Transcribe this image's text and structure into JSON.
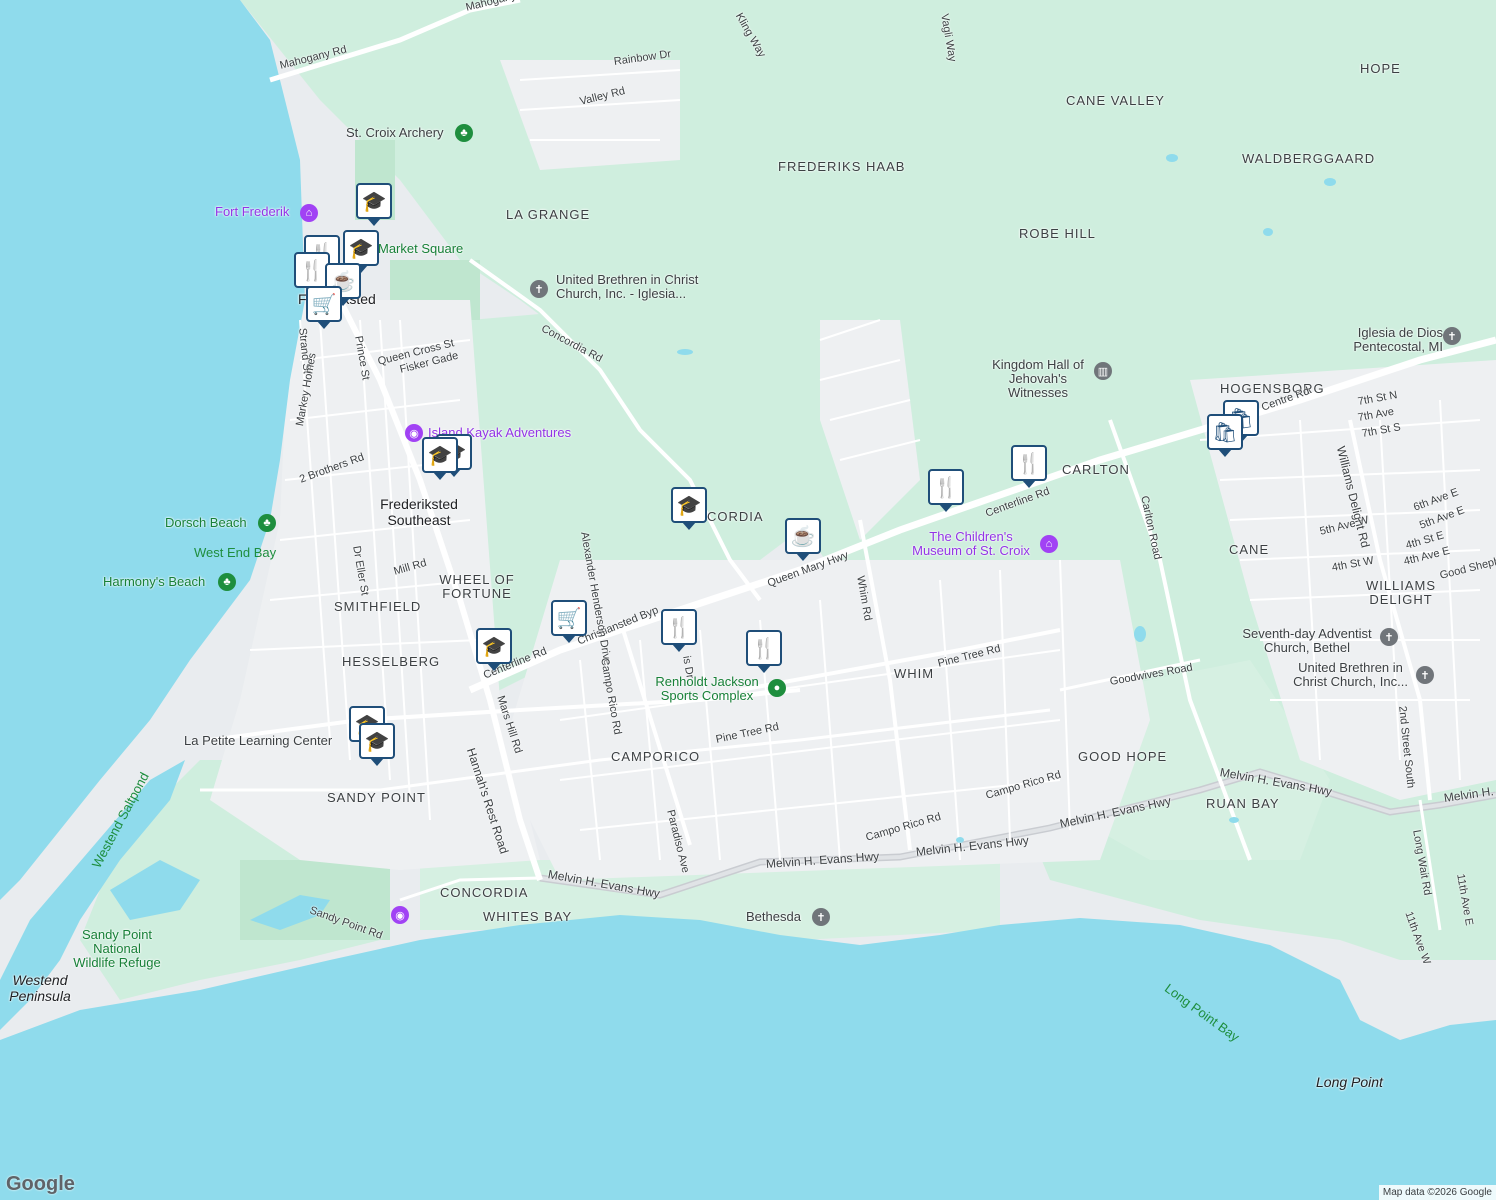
{
  "colors": {
    "land": "#e9ecef",
    "green": "#cfeede",
    "park": "#bfe6cf",
    "water": "#8fdbec",
    "road": "#ffffff",
    "highway": "#c9ccd1",
    "pin": "#1f4e79"
  },
  "areas": [
    "HOPE",
    "CANE VALLEY",
    "WALDBERGGAARD",
    "FREDERIKS HAAB",
    "ROBE HILL",
    "LA GRANGE",
    "HOGENSBORG",
    "CARLTON",
    "CANE",
    "WILLIAMS DELIGHT",
    "WHEEL OF FORTUNE",
    "SMITHFIELD",
    "HESSELBERG",
    "WHIM",
    "CAMPORICO",
    "GOOD HOPE",
    "RUAN BAY",
    "SANDY POINT",
    "CONCORDIA",
    "WHITES BAY",
    "CORDIA"
  ],
  "towns": [
    "Frederiksted",
    "Frederiksted Southeast"
  ],
  "roads": [
    "Mahogany Rd",
    "Mahogany Rd",
    "Rainbow Dr",
    "Valley Rd",
    "Kling Way",
    "Vagli Way",
    "Concordia Rd",
    "Strand St",
    "Prince St",
    "Queen Cross St",
    "Fisker Gade",
    "Markey Homes",
    "2 Brothers Rd",
    "Dr Eller St",
    "Mill Rd",
    "Centerline Rd",
    "Christiansted Byp",
    "Queen Mary Hwy",
    "Centerline Rd",
    "Alexander Henderson Drive",
    "Campo Rico Rd",
    "Mars Hill Rd",
    "Hannah's Rest Road",
    "Whim Rd",
    "Pine Tree Rd",
    "Pine Tree Rd",
    "Paradiso Ave",
    "Campo Rico Rd",
    "Campo Rico Rd",
    "Melvin H. Evans Hwy",
    "Melvin H. Evans Hwy",
    "Melvin H. Evans Hwy",
    "Melvin H. Evans Hwy",
    "Melvin H. Evans Hwy",
    "Melvin H. Evans Hwy",
    "Goodwives Road",
    "Carlton Road",
    "Williams Delight Rd",
    "2nd Street South",
    "Long Wait Rd",
    "11th Ave E",
    "11th Ave W",
    "7th St N",
    "7th Ave",
    "7th St S",
    "6th Ave E",
    "5th Ave W",
    "5th Ave E",
    "4th St E",
    "4th St W",
    "4th Ave E",
    "Good Sheph",
    "Sandy Point Rd",
    "Centre Rd",
    "is Dr"
  ],
  "pois": [
    {
      "name": "St. Croix Archery",
      "icon": "tree-icon"
    },
    {
      "name": "Fort Frederik",
      "icon": "museum-icon"
    },
    {
      "name": "Market Square",
      "icon": "square-icon"
    },
    {
      "name": "United Brethren in Christ Church, Inc. - Iglesia...",
      "icon": "church-icon"
    },
    {
      "name": "Island Kayak Adventures",
      "icon": "camera-icon"
    },
    {
      "name": "Dorsch Beach",
      "icon": "tree-icon"
    },
    {
      "name": "Harmony's Beach",
      "icon": "tree-icon"
    },
    {
      "name": "Kingdom Hall of Jehovah's Witnesses",
      "icon": "hall-icon"
    },
    {
      "name": "Iglesia de Dios Pentecostal, MI",
      "icon": "church-icon"
    },
    {
      "name": "The Children's Museum of St. Croix",
      "icon": "museum-icon"
    },
    {
      "name": "Renholdt Jackson Sports Complex",
      "icon": "sports-icon"
    },
    {
      "name": "Seventh-day Adventist Church, Bethel",
      "icon": "church-icon"
    },
    {
      "name": "United Brethren in Christ Church, Inc...",
      "icon": "church-icon"
    },
    {
      "name": "La Petite Learning Center",
      "icon": "school-icon"
    },
    {
      "name": "Bethesda",
      "icon": "church-icon"
    },
    {
      "name": "Sandy Point National Wildlife Refuge",
      "icon": "park-icon"
    }
  ],
  "water_labels": [
    "West End Bay",
    "Westend Saltpond",
    "Long Point Bay"
  ],
  "natural_labels": [
    "Westend Peninsula",
    "Long Point"
  ],
  "pins": [
    "school-pin",
    "restaurant-pin",
    "school-pin",
    "restaurant-pin",
    "cafe-pin",
    "shopping-cart-pin",
    "school-pin",
    "school-pin",
    "school-pin",
    "cafe-pin",
    "restaurant-pin",
    "restaurant-pin",
    "shopping-bag-pin",
    "shopping-bag-pin",
    "shopping-cart-pin",
    "school-pin",
    "restaurant-pin",
    "restaurant-pin",
    "school-pin",
    "school-pin"
  ],
  "pin_glyphs": {
    "school": "🎓",
    "restaurant": "🍴",
    "cafe": "☕",
    "cart": "🛒",
    "bag": "🛍"
  },
  "footer": {
    "logo": "Google",
    "attribution": "Map data ©2026 Google"
  }
}
